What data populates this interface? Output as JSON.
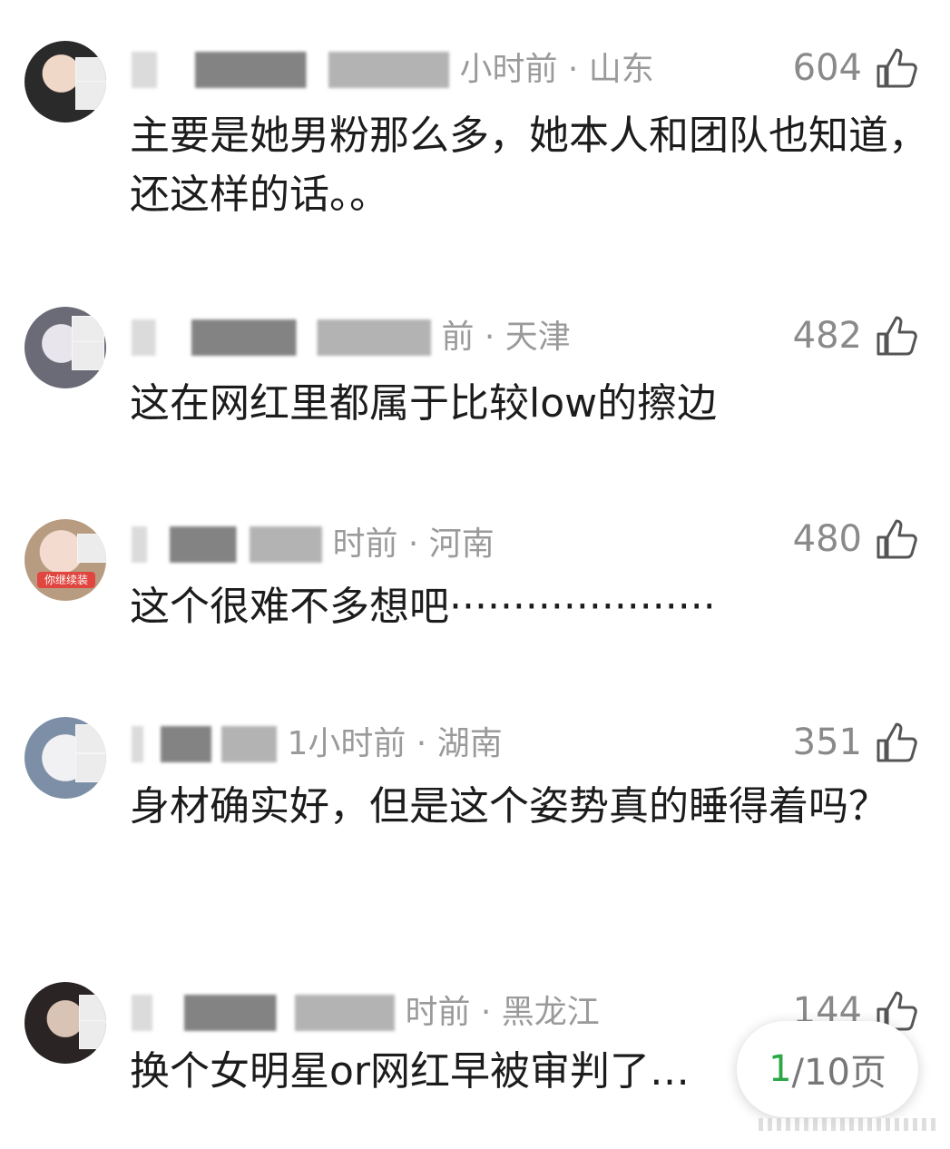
{
  "comments": [
    {
      "time_location": "小时前 · 山东",
      "likes": "604",
      "text": "主要是她男粉那么多，她本人和团队也知道，还这样的话。。"
    },
    {
      "time_location": "前 · 天津",
      "likes": "482",
      "text": "这在网红里都属于比较low的擦边"
    },
    {
      "time_location": "时前 · 河南",
      "likes": "480",
      "text": "这个很难不多想吧·····················"
    },
    {
      "time_location": "1小时前 · 湖南",
      "likes": "351",
      "text": "身材确实好，但是这个姿势真的睡得着吗？"
    },
    {
      "time_location": "时前 · 黑龙江",
      "likes": "144",
      "text": "换个女明星or网红早被审判了…"
    }
  ],
  "avatar_badge": "你继续装",
  "pager": {
    "current": "1",
    "total": "/10页"
  },
  "colors": {
    "pager_current": "#2aa845",
    "meta_gray": "#9a9a9a"
  },
  "icons": {
    "like": "thumbs-up-icon"
  }
}
